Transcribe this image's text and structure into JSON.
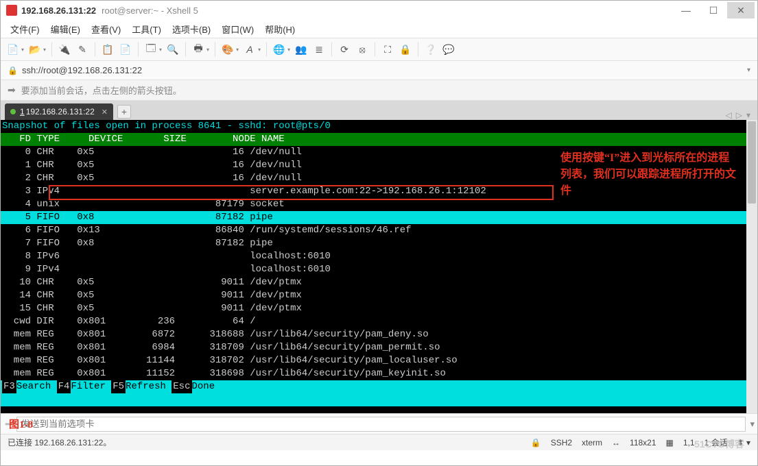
{
  "titlebar": {
    "address": "192.168.26.131:22",
    "title": "root@server:~ - Xshell 5"
  },
  "menu": [
    "文件(F)",
    "编辑(E)",
    "查看(V)",
    "工具(T)",
    "选项卡(B)",
    "窗口(W)",
    "帮助(H)"
  ],
  "address_bar": {
    "url": "ssh://root@192.168.26.131:22"
  },
  "hint": "要添加当前会话，点击左侧的箭头按钮。",
  "tab": {
    "label": "192.168.26.131:22",
    "prefix": "1"
  },
  "terminal": {
    "snapshot": "Snapshot of files open in process 8641 - sshd: root@pts/0",
    "header": "   FD TYPE     DEVICE       SIZE        NODE NAME",
    "rows": [
      {
        "fd": "0",
        "type": "CHR",
        "device": "0x5",
        "size": "",
        "node": "16",
        "name": "/dev/null",
        "hl": false,
        "red": false
      },
      {
        "fd": "1",
        "type": "CHR",
        "device": "0x5",
        "size": "",
        "node": "16",
        "name": "/dev/null",
        "hl": false,
        "red": false
      },
      {
        "fd": "2",
        "type": "CHR",
        "device": "0x5",
        "size": "",
        "node": "16",
        "name": "/dev/null",
        "hl": false,
        "red": false
      },
      {
        "fd": "3",
        "type": "IPv4",
        "device": "",
        "size": "",
        "node": "",
        "name": "server.example.com:22->192.168.26.1:12102",
        "hl": false,
        "red": true
      },
      {
        "fd": "4",
        "type": "unix",
        "device": "",
        "size": "",
        "node": "87179",
        "name": "socket",
        "hl": false,
        "red": false
      },
      {
        "fd": "5",
        "type": "FIFO",
        "device": "0x8",
        "size": "",
        "node": "87182",
        "name": "pipe",
        "hl": true,
        "red": false
      },
      {
        "fd": "6",
        "type": "FIFO",
        "device": "0x13",
        "size": "",
        "node": "86840",
        "name": "/run/systemd/sessions/46.ref",
        "hl": false,
        "red": false
      },
      {
        "fd": "7",
        "type": "FIFO",
        "device": "0x8",
        "size": "",
        "node": "87182",
        "name": "pipe",
        "hl": false,
        "red": false
      },
      {
        "fd": "8",
        "type": "IPv6",
        "device": "",
        "size": "",
        "node": "",
        "name": "localhost:6010",
        "hl": false,
        "red": false
      },
      {
        "fd": "9",
        "type": "IPv4",
        "device": "",
        "size": "",
        "node": "",
        "name": "localhost:6010",
        "hl": false,
        "red": false
      },
      {
        "fd": "10",
        "type": "CHR",
        "device": "0x5",
        "size": "",
        "node": "9011",
        "name": "/dev/ptmx",
        "hl": false,
        "red": false
      },
      {
        "fd": "14",
        "type": "CHR",
        "device": "0x5",
        "size": "",
        "node": "9011",
        "name": "/dev/ptmx",
        "hl": false,
        "red": false
      },
      {
        "fd": "15",
        "type": "CHR",
        "device": "0x5",
        "size": "",
        "node": "9011",
        "name": "/dev/ptmx",
        "hl": false,
        "red": false
      },
      {
        "fd": "cwd",
        "type": "DIR",
        "device": "0x801",
        "size": "236",
        "node": "64",
        "name": "/",
        "hl": false,
        "red": false
      },
      {
        "fd": "mem",
        "type": "REG",
        "device": "0x801",
        "size": "6872",
        "node": "318688",
        "name": "/usr/lib64/security/pam_deny.so",
        "hl": false,
        "red": false
      },
      {
        "fd": "mem",
        "type": "REG",
        "device": "0x801",
        "size": "6984",
        "node": "318709",
        "name": "/usr/lib64/security/pam_permit.so",
        "hl": false,
        "red": false
      },
      {
        "fd": "mem",
        "type": "REG",
        "device": "0x801",
        "size": "11144",
        "node": "318702",
        "name": "/usr/lib64/security/pam_localuser.so",
        "hl": false,
        "red": false
      },
      {
        "fd": "mem",
        "type": "REG",
        "device": "0x801",
        "size": "11152",
        "node": "318698",
        "name": "/usr/lib64/security/pam_keyinit.so",
        "hl": false,
        "red": false
      }
    ],
    "footer": [
      {
        "key": "F3",
        "label": "Search"
      },
      {
        "key": "F4",
        "label": "Filter"
      },
      {
        "key": "F5",
        "label": "Refresh"
      },
      {
        "key": "Esc",
        "label": "Done"
      }
    ]
  },
  "annotation": "使用按键“I”进入到光标所在的进程列表，我们可以跟踪进程所打开的文件",
  "figure_label": "图1-8",
  "send": {
    "placeholder": "发送到当前选项卡"
  },
  "status": {
    "left": "已连接 192.168.26.131:22。",
    "ssh": "SSH2",
    "term": "xterm",
    "size": "118x21",
    "pos": "1,1",
    "sessions": "1 会话"
  },
  "watermark": "51CTO博客"
}
